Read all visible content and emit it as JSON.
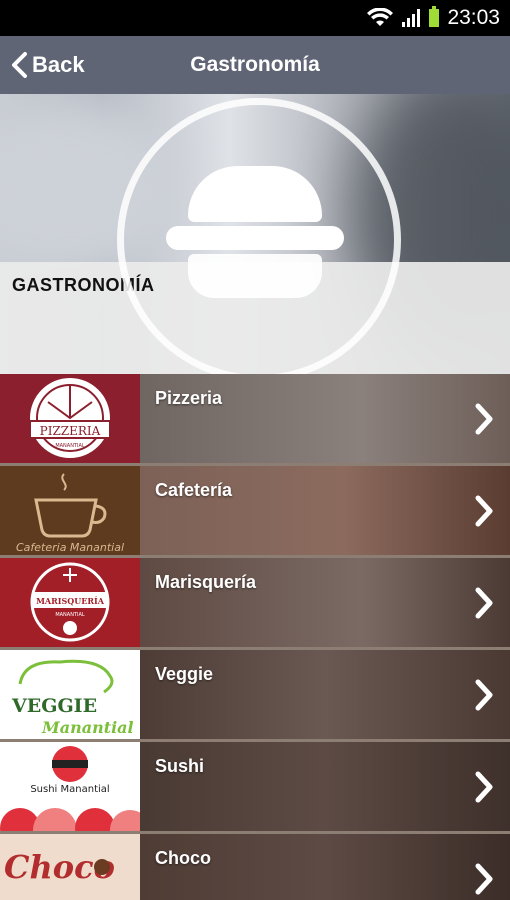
{
  "status_bar": {
    "time": "23:03"
  },
  "nav": {
    "back_label": "Back",
    "title": "Gastronomía"
  },
  "header": {
    "section_title": "GASTRONOMÍA"
  },
  "items": [
    {
      "label": "Pizzeria",
      "thumb_text": "PIZZERIA",
      "thumb_sub": "MANANTIAL"
    },
    {
      "label": "Cafetería",
      "thumb_text": "Cafeteria Manantial"
    },
    {
      "label": "Marisquería",
      "thumb_text": "MARISQUERÍA",
      "thumb_sub": "MANANTIAL"
    },
    {
      "label": "Veggie",
      "thumb_text": "VEGGIE",
      "thumb_sub": "Manantial"
    },
    {
      "label": "Sushi",
      "thumb_text": "Sushi Manantial"
    },
    {
      "label": "Choco",
      "thumb_text": "Choco"
    }
  ],
  "icons": {
    "back": "chevron-left-icon",
    "row": "chevron-right-icon",
    "header": "burger-icon"
  },
  "colors": {
    "navbar": "#5f6575",
    "statusbar": "#000000",
    "battery": "#9fdc35"
  }
}
